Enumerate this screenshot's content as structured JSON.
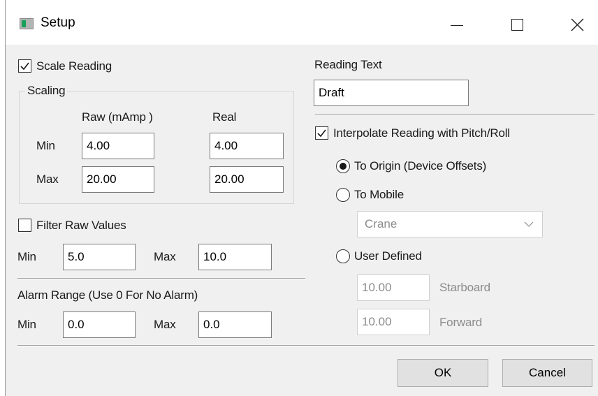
{
  "window": {
    "title": "Setup",
    "controls": {
      "minimize": "minimize",
      "maximize": "maximize",
      "close": "close"
    }
  },
  "scale_reading": {
    "checked": true,
    "label": "Scale Reading",
    "group_title": "Scaling",
    "col_raw": "Raw (mAmp )",
    "col_real": "Real",
    "row_min": "Min",
    "row_max": "Max",
    "raw_min": "4.00",
    "raw_max": "20.00",
    "real_min": "4.00",
    "real_max": "20.00"
  },
  "filter": {
    "checked": false,
    "label": "Filter Raw Values",
    "min_label": "Min",
    "min_value": "5.0",
    "max_label": "Max",
    "max_value": "10.0"
  },
  "alarm": {
    "label": "Alarm Range (Use 0  For No Alarm)",
    "min_label": "Min",
    "min_value": "0.0",
    "max_label": "Max",
    "max_value": "0.0"
  },
  "reading_text": {
    "label": "Reading Text",
    "value": "Draft"
  },
  "interpolate": {
    "checked": true,
    "label": "Interpolate Reading with Pitch/Roll",
    "selected": "origin",
    "option_origin": "To Origin (Device Offsets)",
    "option_mobile": "To Mobile",
    "mobile_select": "Crane",
    "option_user": "User Defined",
    "starboard_value": "10.00",
    "starboard_label": "Starboard",
    "forward_value": "10.00",
    "forward_label": "Forward"
  },
  "buttons": {
    "ok": "OK",
    "cancel": "Cancel"
  },
  "colors": {
    "dialog_bg": "#f0f0f0",
    "titlebar_bg": "#ffffff",
    "icon_accent": "#16a05a",
    "disabled_text": "#8c8c8c"
  }
}
